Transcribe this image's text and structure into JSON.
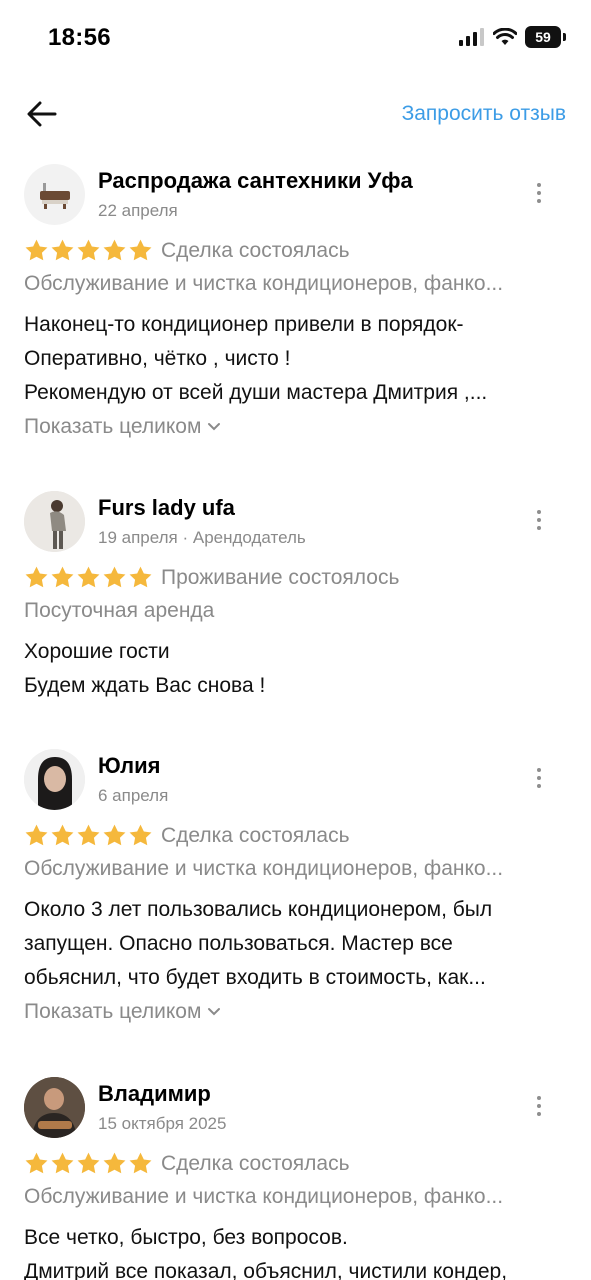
{
  "status_bar": {
    "time": "18:56",
    "battery": "59"
  },
  "header": {
    "request_review": "Запросить отзыв"
  },
  "reviews": [
    {
      "author": "Распродажа сантехники Уфа",
      "meta": "22 апреля",
      "rating": 5,
      "status": "Сделка состоялась",
      "service": "Обслуживание и чистка кондиционеров, фанко...",
      "lines": [
        "Наконец-то кондиционер привели в порядок-",
        "Оперативно, чётко , чисто !",
        "Рекомендую от всей души мастера Дмитрия ,..."
      ],
      "show_more": "Показать целиком"
    },
    {
      "author": "Furs lady ufa",
      "meta": "19 апреля · Арендодатель",
      "rating": 5,
      "status": "Проживание состоялось",
      "service": "Посуточная аренда",
      "lines": [
        "Хорошие гости",
        "Будем ждать Вас снова !"
      ]
    },
    {
      "author": "Юлия",
      "meta": "6 апреля",
      "rating": 5,
      "status": "Сделка состоялась",
      "service": "Обслуживание и чистка кондиционеров, фанко...",
      "lines": [
        "Около 3 лет пользовались кондиционером, был",
        "запущен. Опасно пользоваться. Мастер все",
        "обьяснил, что будет входить в стоимость, как..."
      ],
      "show_more": "Показать целиком"
    },
    {
      "author": "Владимир",
      "meta": "15 октября 2025",
      "rating": 5,
      "status": "Сделка состоялась",
      "service": "Обслуживание и чистка кондиционеров, фанко...",
      "lines": [
        "Все четко, быстро, без вопросов.",
        "Дмитрий все показал, объяснил, чистили кондер,"
      ]
    }
  ],
  "colors": {
    "accent": "#3c9ce6",
    "star": "#f5b83c",
    "muted": "#8a8a8a"
  },
  "icons": {
    "back": "arrow-left-icon",
    "more": "more-vertical-icon",
    "star": "star-icon",
    "chevron": "chevron-down-icon"
  }
}
